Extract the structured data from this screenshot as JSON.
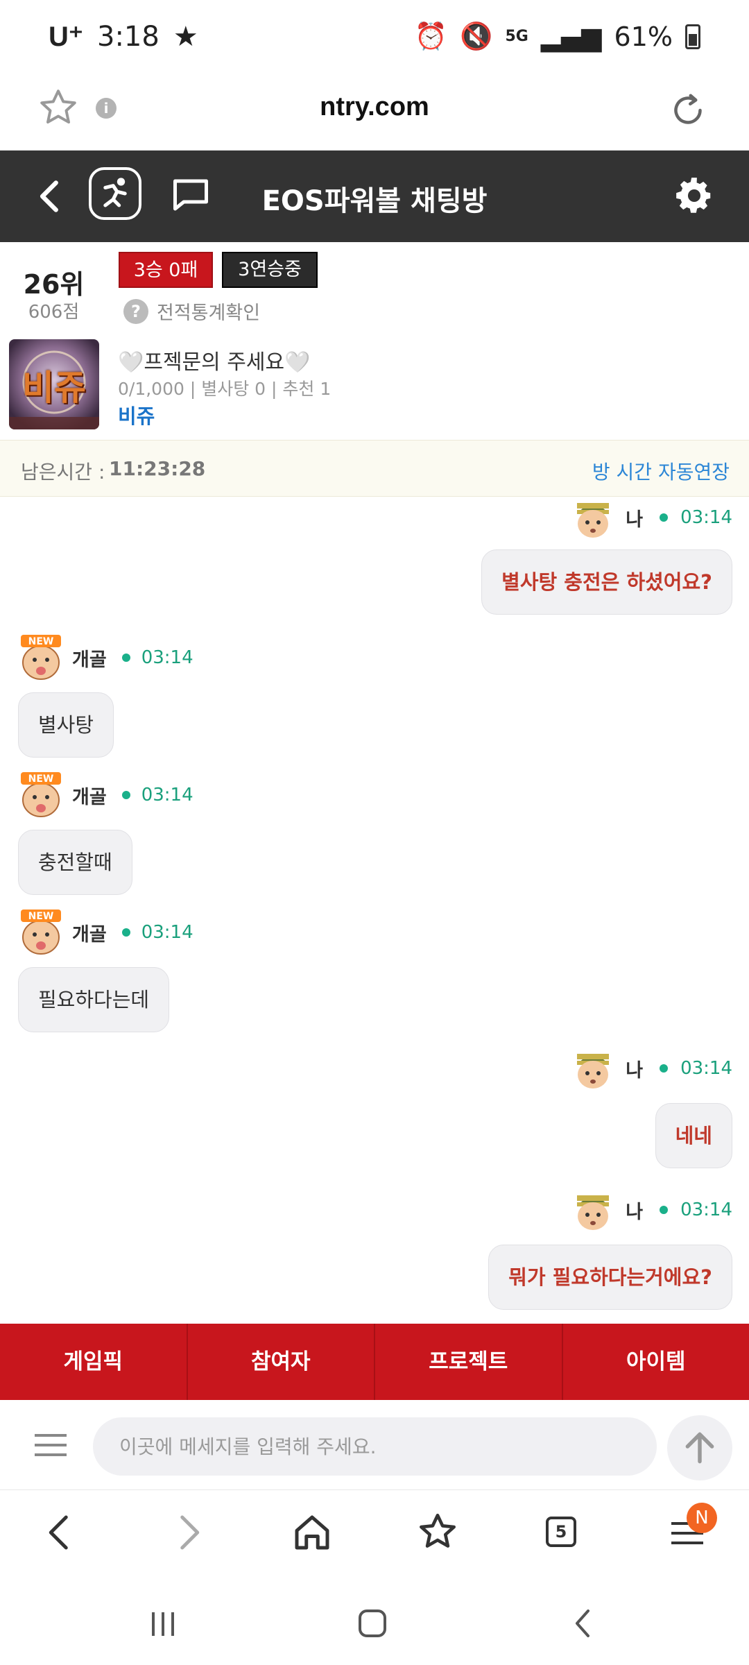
{
  "status_bar": {
    "carrier": "U⁺",
    "time": "3:18",
    "network": "5G",
    "battery": "61%"
  },
  "browser": {
    "url": "ntry.com",
    "tab_count": "5",
    "menu_badge": "N"
  },
  "chat_header": {
    "title": "EOS파워볼 채팅방"
  },
  "user_rank": {
    "rank": "26위",
    "points": "606점",
    "record_badge": "3승 0패",
    "streak_badge": "3연승중",
    "stats_link": "전적통계확인"
  },
  "room": {
    "thumb_text": "비쥬",
    "name": "🤍프젝문의 주세요🤍",
    "meta": "0/1,000 | 별사탕 0 | 추천 1",
    "owner": "비쥬"
  },
  "timer": {
    "label": "남은시간 :",
    "value": "11:23:28",
    "extend": "방 시간 자동연장"
  },
  "messages": [
    {
      "mine": true,
      "nick": "나",
      "time": "03:14",
      "text": "별사탕 충전은 하셨어요?"
    },
    {
      "mine": false,
      "nick": "개골",
      "time": "03:14",
      "text": "별사탕"
    },
    {
      "mine": false,
      "nick": "개골",
      "time": "03:14",
      "text": "충전할때"
    },
    {
      "mine": false,
      "nick": "개골",
      "time": "03:14",
      "text": "필요하다는데"
    },
    {
      "mine": true,
      "nick": "나",
      "time": "03:14",
      "text": "네네"
    },
    {
      "mine": true,
      "nick": "나",
      "time": "03:14",
      "text": "뭐가 필요하다는거에요?"
    }
  ],
  "tabs": [
    "게임픽",
    "참여자",
    "프로젝트",
    "아이템"
  ],
  "input": {
    "placeholder": "이곳에 메세지를 입력해 주세요."
  },
  "colors": {
    "accent_red": "#c8161d",
    "header_dark": "#333333",
    "time_green": "#1aa07c",
    "link_blue": "#2c86d6"
  }
}
